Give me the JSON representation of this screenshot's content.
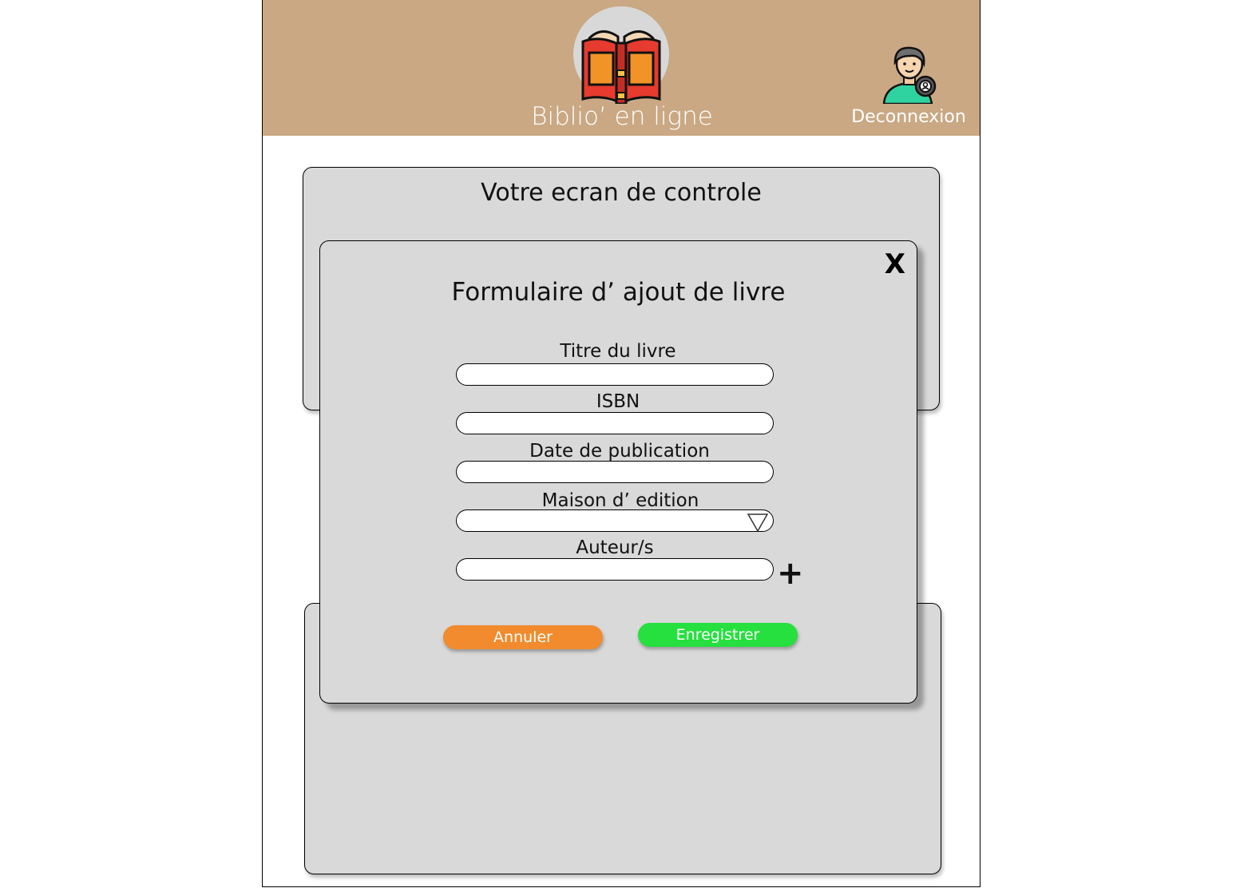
{
  "header": {
    "app_title": "Biblio’ en ligne",
    "logout_label": "Deconnexion",
    "background_color": "#c9a883",
    "logo_icon": "open-book-icon",
    "user_icon": "user-account-icon"
  },
  "dashboard": {
    "title": "Votre ecran de controle"
  },
  "modal": {
    "close_label": "X",
    "title": "Formulaire d’ ajout de livre",
    "fields": [
      {
        "label": "Titre du livre",
        "value": ""
      },
      {
        "label": "ISBN",
        "value": ""
      },
      {
        "label": "Date de publication",
        "value": ""
      },
      {
        "label": "Maison d’ edition",
        "value": ""
      },
      {
        "label": "Auteur/s",
        "value": ""
      }
    ],
    "add_author_label": "+",
    "cancel_label": "Annuler",
    "save_label": "Enregistrer",
    "colors": {
      "cancel": "#f18b2d",
      "save": "#25e03e",
      "panel": "#d9d9d9"
    }
  }
}
